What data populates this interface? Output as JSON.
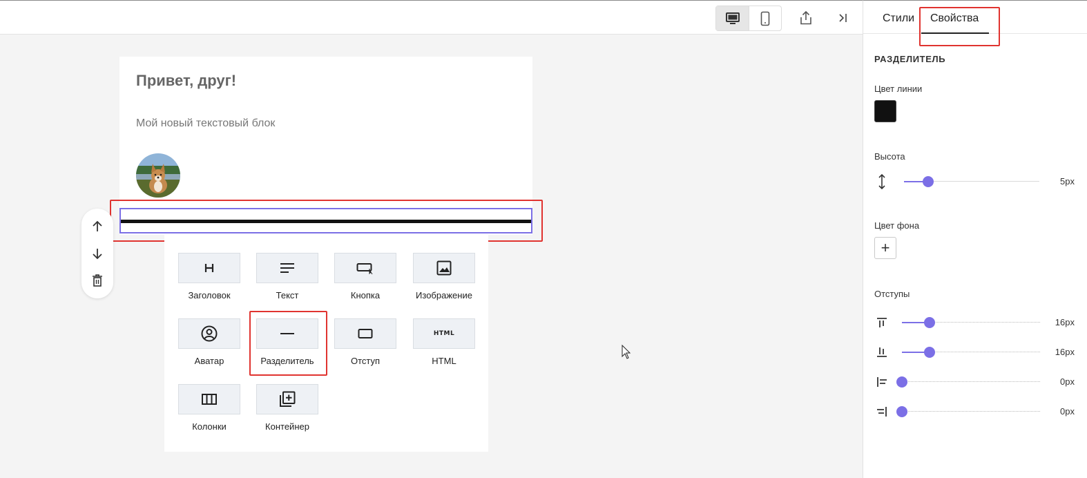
{
  "toolbar": {
    "desktop_icon": "desktop-icon",
    "mobile_icon": "mobile-icon",
    "export_icon": "share-icon",
    "collapse_icon": "collapse-panel-icon"
  },
  "panel": {
    "tabs": [
      {
        "label": "Стили"
      },
      {
        "label": "Свойства"
      }
    ],
    "section_title": "РАЗДЕЛИТЕЛЬ",
    "line_color_label": "Цвет линии",
    "line_color": "#111111",
    "height_label": "Высота",
    "height_value": "5px",
    "height_level": 0.18,
    "bg_color_label": "Цвет фона",
    "bg_add": "+",
    "padding_label": "Отступы",
    "paddings": [
      {
        "icon": "padding-top-icon",
        "value": "16px",
        "level": 0.2
      },
      {
        "icon": "padding-bottom-icon",
        "value": "16px",
        "level": 0.2
      },
      {
        "icon": "padding-left-icon",
        "value": "0px",
        "level": 0
      },
      {
        "icon": "padding-right-icon",
        "value": "0px",
        "level": 0
      }
    ]
  },
  "email": {
    "heading": "Привет, друг!",
    "text": "Мой новый текстовый блок",
    "avatar_icon": "corgi-avatar"
  },
  "blocks": [
    {
      "label": "Заголовок",
      "icon": "heading-icon"
    },
    {
      "label": "Текст",
      "icon": "text-icon"
    },
    {
      "label": "Кнопка",
      "icon": "button-icon"
    },
    {
      "label": "Изображение",
      "icon": "image-icon"
    },
    {
      "label": "Аватар",
      "icon": "avatar-icon"
    },
    {
      "label": "Разделитель",
      "icon": "divider-icon"
    },
    {
      "label": "Отступ",
      "icon": "spacer-icon"
    },
    {
      "label": "HTML",
      "icon": "html-icon"
    },
    {
      "label": "Колонки",
      "icon": "columns-icon"
    },
    {
      "label": "Контейнер",
      "icon": "container-icon"
    }
  ],
  "colors": {
    "accent": "#7b6fe6",
    "highlight": "#e0332f"
  }
}
